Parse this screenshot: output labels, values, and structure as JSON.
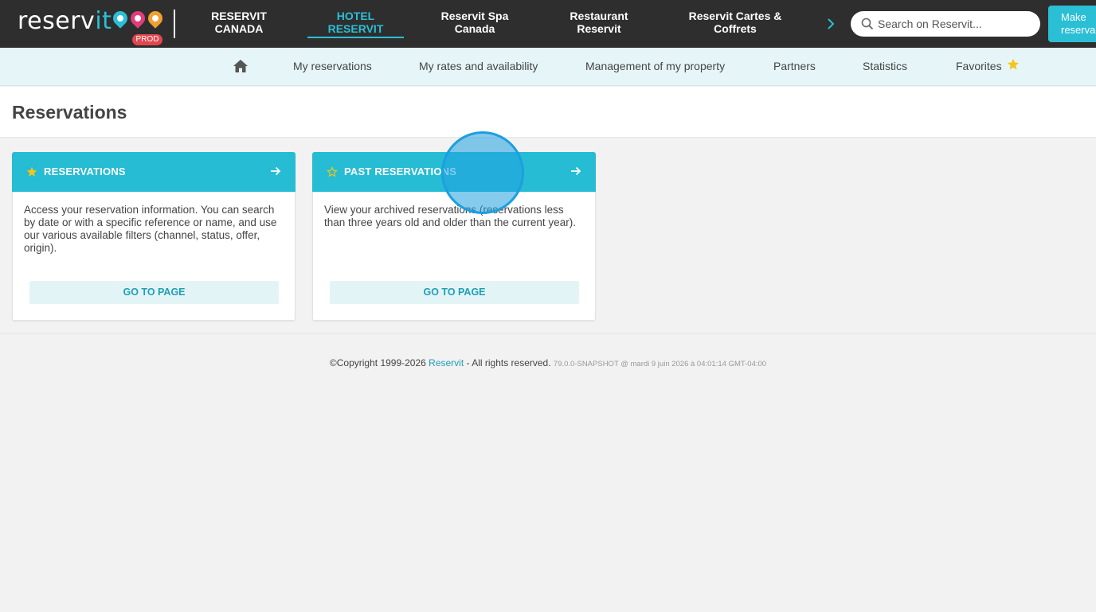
{
  "logo": {
    "text_main": "reserv",
    "text_accent": "it",
    "env_badge": "PROD"
  },
  "brand_tabs": [
    {
      "line1": "RESERVIT",
      "line2": "CANADA",
      "active": false
    },
    {
      "line1": "HOTEL",
      "line2": "RESERVIT",
      "active": true
    },
    {
      "line1": "Reservit Spa",
      "line2": "Canada",
      "active": false
    },
    {
      "line1": "Restaurant",
      "line2": "Reservit",
      "active": false
    },
    {
      "line1": "Reservit Cartes &",
      "line2": "Coffrets",
      "active": false
    }
  ],
  "search": {
    "placeholder": "Search on Reservit..."
  },
  "make_button": {
    "line1": "Make",
    "line2": "reserva"
  },
  "subnav": {
    "items": [
      "My reservations",
      "My rates and availability",
      "Management of my property",
      "Partners",
      "Statistics",
      "Favorites"
    ]
  },
  "page": {
    "title": "Reservations"
  },
  "cards": [
    {
      "title": "RESERVATIONS",
      "description": "Access your reservation information. You can search by date or with a specific reference or name, and use our various available filters (channel, status, offer, origin).",
      "button": "GO TO PAGE",
      "favorite": true
    },
    {
      "title": "PAST RESERVATIONS",
      "description": "View your archived reservations (reservations less than three years old and older than the current year).",
      "button": "GO TO PAGE",
      "favorite": false
    }
  ],
  "footer": {
    "copyright": "©Copyright 1999-2026 ",
    "brand": "Reservit",
    "rights": " - All rights reserved. ",
    "build": "79.0.0-SNAPSHOT @ mardi 9 juin 2026 à 04:01:14 GMT-04:00"
  },
  "colors": {
    "accent": "#26bcd4",
    "topbar": "#2e2e2e",
    "star": "#f5c518",
    "badge": "#e0484f"
  }
}
